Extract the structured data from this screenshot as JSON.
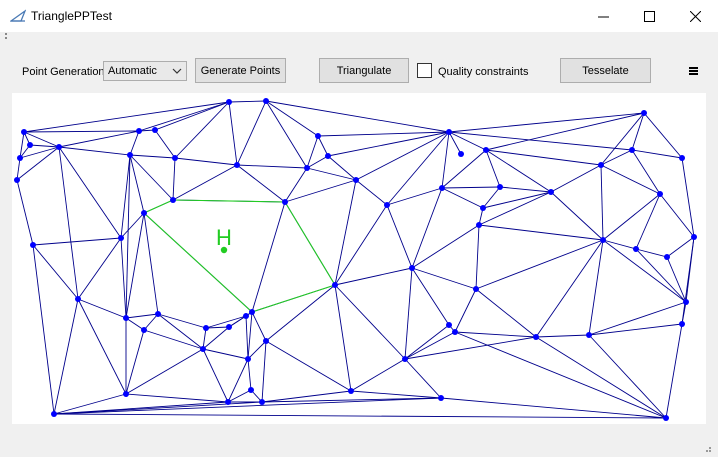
{
  "window": {
    "title": "TrianglePPTest"
  },
  "toolbar": {
    "point_generation_label": "Point Generation",
    "point_generation_value": "Automatic",
    "generate_points_label": "Generate Points",
    "triangulate_label": "Triangulate",
    "quality_constraints_label": "Quality constraints",
    "quality_constraints_checked": false,
    "tesselate_label": "Tesselate"
  },
  "canvas": {
    "hole_label": "H",
    "mesh_color": "#00008b",
    "point_color": "#0000ff",
    "hole_color": "#22cc22"
  },
  "colors": {
    "titlebar_bg": "#ffffff",
    "window_bg": "#f0f0f0",
    "button_bg": "#e1e1e1"
  }
}
